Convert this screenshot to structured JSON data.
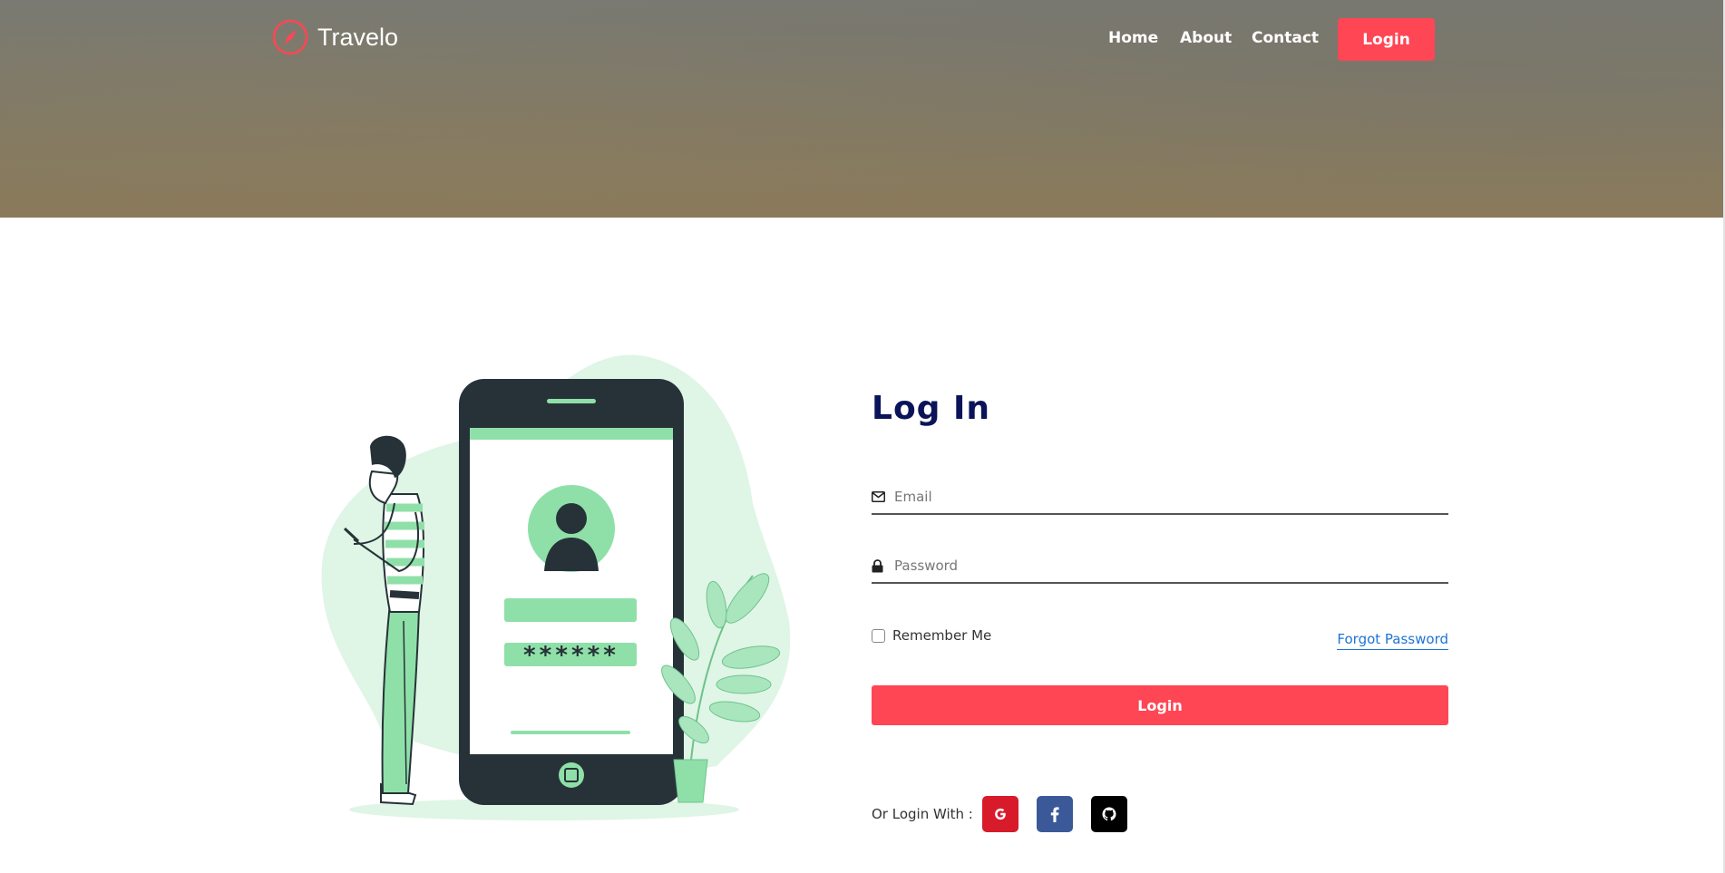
{
  "brand": {
    "name": "Travelo",
    "icon": "compass-icon"
  },
  "nav": {
    "home": "Home",
    "about": "About",
    "contact": "Contact",
    "login": "Login"
  },
  "login_form": {
    "title": "Log In",
    "email": {
      "placeholder": "Email",
      "value": "",
      "icon": "envelope-icon"
    },
    "password": {
      "placeholder": "Password",
      "value": "",
      "icon": "lock-icon"
    },
    "remember_label": "Remember Me",
    "remember_checked": false,
    "forgot_label": "Forgot Password",
    "submit_label": "Login",
    "social_label": "Or Login With :",
    "social": [
      {
        "name": "google",
        "icon": "google-icon"
      },
      {
        "name": "facebook",
        "icon": "facebook-icon"
      },
      {
        "name": "github",
        "icon": "github-icon"
      }
    ]
  },
  "illustration": {
    "password_mask": "******"
  },
  "colors": {
    "accent": "#ff4654",
    "title": "#0b1458",
    "link": "#1e74d6",
    "illustration_green": "#8fe0a8",
    "illustration_dark": "#263238"
  }
}
